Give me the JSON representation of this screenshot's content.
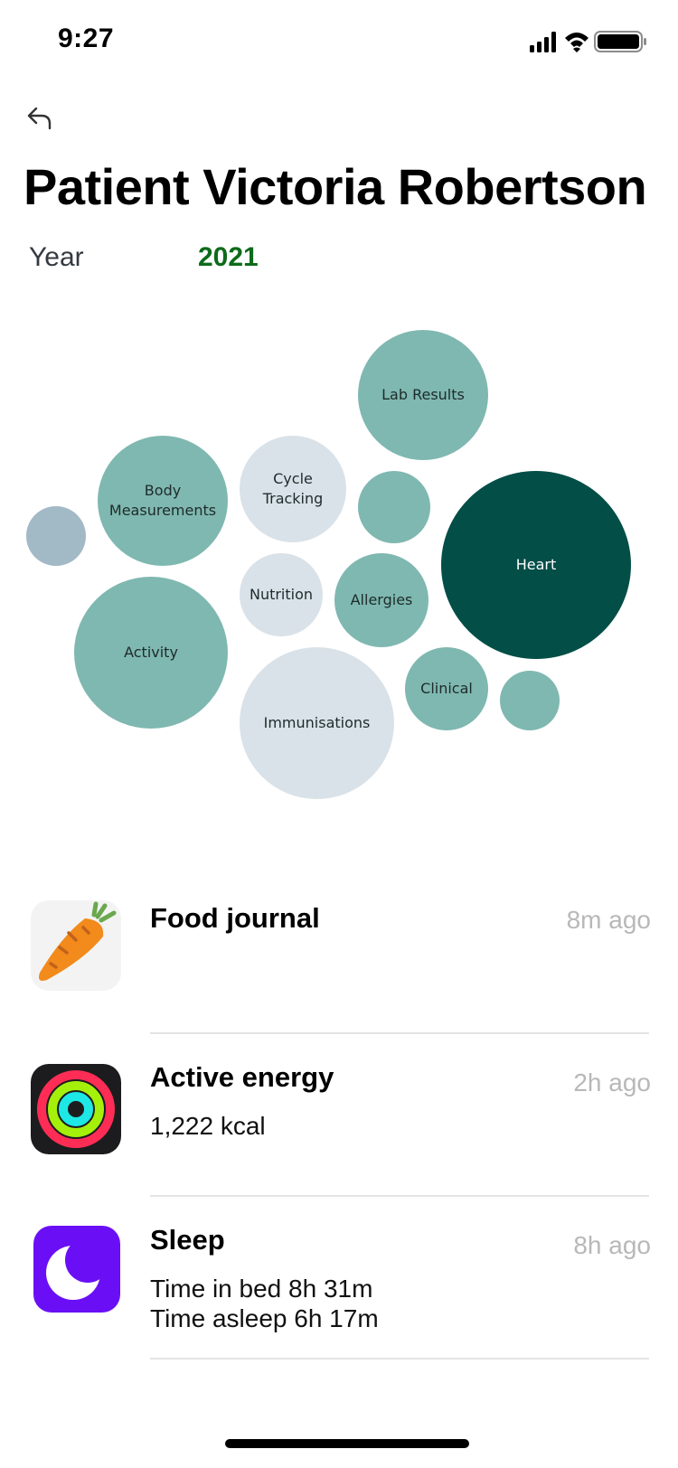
{
  "status_bar": {
    "time": "9:27"
  },
  "header": {
    "title": "Patient Victoria Robertson",
    "year_label": "Year",
    "year_value": "2021",
    "year_color": "#0d6b1a"
  },
  "bubbles": {
    "lab_results": "Lab Results",
    "body_measurements": "Body\nMeasurements",
    "cycle_tracking": "Cycle\nTracking",
    "heart": "Heart",
    "nutrition": "Nutrition",
    "allergies": "Allergies",
    "activity": "Activity",
    "clinical": "Clinical",
    "immunisations": "Immunisations"
  },
  "colors": {
    "bubble_teal": "#7fb8b0",
    "bubble_light": "#d9e2e8",
    "bubble_slate": "#a2b9c6",
    "bubble_dark": "#034e47"
  },
  "feed": [
    {
      "title": "Food journal",
      "time": "8m ago",
      "lines": [],
      "icon": "carrot-icon"
    },
    {
      "title": "Active energy",
      "time": "2h ago",
      "lines": [
        "1,222 kcal"
      ],
      "icon": "activity-rings-icon"
    },
    {
      "title": "Sleep",
      "time": "8h ago",
      "lines": [
        "Time in bed 8h 31m",
        "Time asleep 6h 17m"
      ],
      "icon": "moon-icon"
    }
  ]
}
